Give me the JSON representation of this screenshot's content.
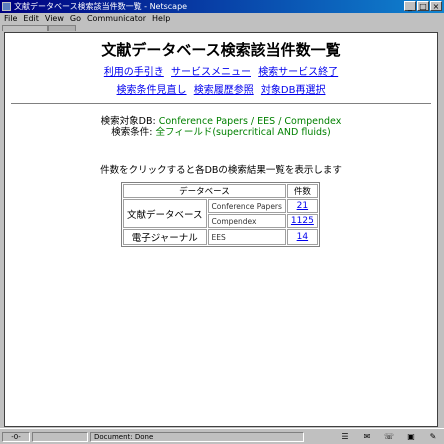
{
  "window": {
    "title": "文献データベース検索該当件数一覧 - Netscape",
    "buttons": [
      "_",
      "□",
      "×"
    ]
  },
  "menu": [
    "File",
    "Edit",
    "View",
    "Go",
    "Communicator",
    "Help"
  ],
  "page": {
    "heading": "文献データベース検索該当件数一覧",
    "links_row1": [
      "利用の手引き",
      "サービスメニュー",
      "検索サービス終了"
    ],
    "links_row2": [
      "検索条件見直し",
      "検索履歴参照",
      "対象DB再選択"
    ],
    "target_db_label": "検索対象DB:",
    "target_db_value": "Conference Papers / EES / Compendex",
    "condition_label": "検索条件:",
    "condition_value": "全フィールド(supercritical AND fluids)",
    "instruction": "件数をクリックすると各DBの検索結果一覧を表示します"
  },
  "table": {
    "header_db": "データベース",
    "header_count": "件数",
    "groups": [
      {
        "category": "文献データベース",
        "rows": [
          {
            "db": "Conference Papers",
            "count": "21"
          },
          {
            "db": "Compendex",
            "count": "1125"
          }
        ]
      },
      {
        "category": "電子ジャーナル",
        "rows": [
          {
            "db": "EES",
            "count": "14"
          }
        ]
      }
    ]
  },
  "status": {
    "text": "Document: Done",
    "left_icon": "-0-"
  },
  "icons": {
    "status_tray": [
      "component-bar-icon",
      "mail-icon",
      "discussion-icon",
      "composer-icon",
      "security-icon"
    ]
  }
}
